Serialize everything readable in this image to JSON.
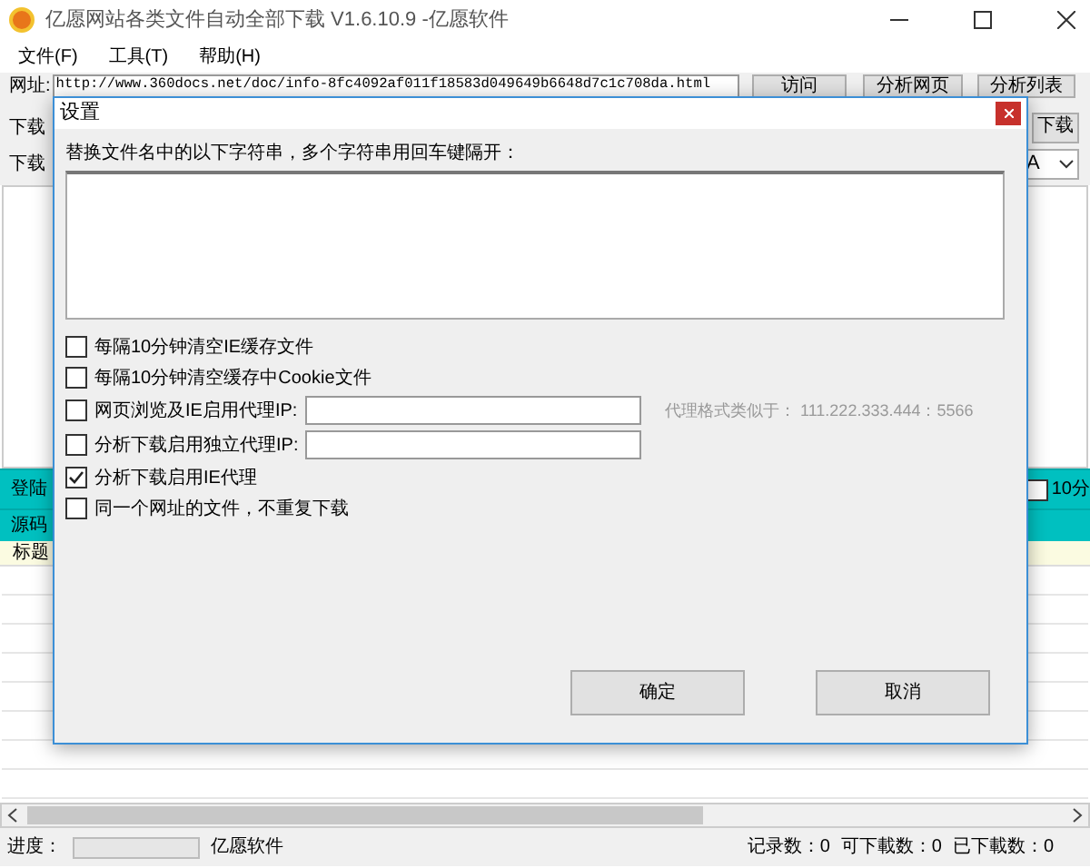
{
  "window": {
    "title": "亿愿网站各类文件自动全部下载 V1.6.10.9 -亿愿软件"
  },
  "menu": [
    "文件(F)",
    "工具(T)",
    "帮助(H)"
  ],
  "toolbar": {
    "url_label": "网址:",
    "url": "http://www.360docs.net/doc/info-8fc4092af011f18583d049649b6648d7c1c708da.html",
    "buttons": [
      "访问",
      "分析网页",
      "分析列表"
    ],
    "row2_label": "下载",
    "row2_button": "下载",
    "row3_label": "下载",
    "row3_combo": "A"
  },
  "panel": {
    "bar_label": "登陆",
    "bar_checkbox": {
      "label": "10分",
      "checked": false
    },
    "source_label": "源码",
    "header_label": "标题"
  },
  "status_bar": {
    "progress_label": "进度：",
    "progress": {
      "level": 0
    },
    "vendor": "亿愿软件",
    "counts": [
      "记录数：0",
      "可下載数：0",
      "已下載数：0"
    ]
  },
  "dialog": {
    "title": "设置",
    "replace_label": "替换文件名中的以下字符串，多个字符串用回车键隔开：",
    "options": [
      {
        "kind": "checkbox",
        "label": "每隔10分钟清空IE缓存文件",
        "checked": false
      },
      {
        "kind": "checkbox",
        "label": "每隔10分钟清空缓存中Cookie文件",
        "checked": false
      },
      {
        "kind": "checkbox_field",
        "label": "网页浏览及IE启用代理IP:",
        "checked": false
      },
      {
        "kind": "checkbox_field",
        "label": "分析下载启用独立代理IP:",
        "checked": false
      },
      {
        "kind": "checkbox",
        "label": "分析下载启用IE代理",
        "checked": true
      },
      {
        "kind": "checkbox",
        "label": "同一个网址的文件，不重复下载",
        "checked": false
      }
    ],
    "proxy_hint": "代理格式类似于： 111.222.333.444：5566",
    "buttons": [
      "确定",
      "取消"
    ]
  }
}
